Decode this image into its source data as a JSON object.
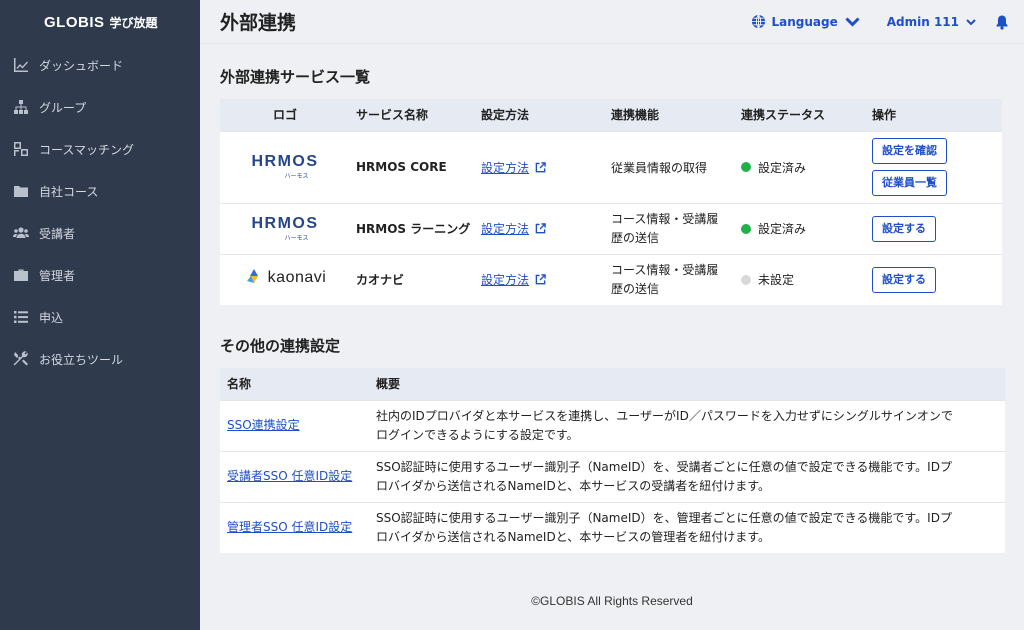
{
  "sidebar": {
    "brand": "GLOBIS",
    "brand_sub": "学び放題",
    "items": [
      {
        "label": "ダッシュボード",
        "icon": "chart-line-icon"
      },
      {
        "label": "グループ",
        "icon": "sitemap-icon"
      },
      {
        "label": "コースマッチング",
        "icon": "match-icon"
      },
      {
        "label": "自社コース",
        "icon": "folder-icon"
      },
      {
        "label": "受講者",
        "icon": "users-icon"
      },
      {
        "label": "管理者",
        "icon": "briefcase-icon"
      },
      {
        "label": "申込",
        "icon": "list-icon"
      },
      {
        "label": "お役立ちツール",
        "icon": "tools-icon"
      }
    ]
  },
  "header": {
    "title": "外部連携",
    "language": "Language",
    "admin": "Admin 111"
  },
  "services": {
    "title": "外部連携サービス一覧",
    "columns": [
      "ロゴ",
      "サービス名称",
      "設定方法",
      "連携機能",
      "連携ステータス",
      "操作"
    ],
    "rows": [
      {
        "logo_text": "HRMOS",
        "logo_sub": "ハーモス",
        "name": "HRMOS CORE",
        "method": "設定方法",
        "function": "従業員情報の取得",
        "status": "設定済み",
        "status_color": "#22b04b",
        "actions": [
          "設定を確認",
          "従業員一覧"
        ]
      },
      {
        "logo_text": "HRMOS",
        "logo_sub": "ハーモス",
        "name": "HRMOS ラーニング",
        "method": "設定方法",
        "function_l1": "コース情報・受講履",
        "function_l2": "歴の送信",
        "status": "設定済み",
        "status_color": "#22b04b",
        "actions": [
          "設定する"
        ]
      },
      {
        "logo_text": "kaonavi",
        "name": "カオナビ",
        "method": "設定方法",
        "function_l1": "コース情報・受講履",
        "function_l2": "歴の送信",
        "status": "未設定",
        "status_color": "#d9d9d9",
        "actions": [
          "設定する"
        ]
      }
    ]
  },
  "other": {
    "title": "その他の連携設定",
    "columns": [
      "名称",
      "概要"
    ],
    "rows": [
      {
        "name": "SSO連携設定",
        "desc_l1": "社内のIDプロバイダと本サービスを連携し、ユーザーがID／パスワードを入力せずにシングルサインオンで",
        "desc_l2": "ログインできるようにする設定です。"
      },
      {
        "name": "受講者SSO 任意ID設定",
        "desc_l1": "SSO認証時に使用するユーザー識別子（NameID）を、受講者ごとに任意の値で設定できる機能です。IDプ",
        "desc_l2": "ロバイダから送信されるNameIDと、本サービスの受講者を紐付けます。"
      },
      {
        "name": "管理者SSO 任意ID設定",
        "desc_l1": "SSO認証時に使用するユーザー識別子（NameID）を、管理者ごとに任意の値で設定できる機能です。IDプ",
        "desc_l2": "ロバイダから送信されるNameIDと、本サービスの管理者を紐付けます。"
      }
    ]
  },
  "footer": "©GLOBIS All Rights Reserved"
}
